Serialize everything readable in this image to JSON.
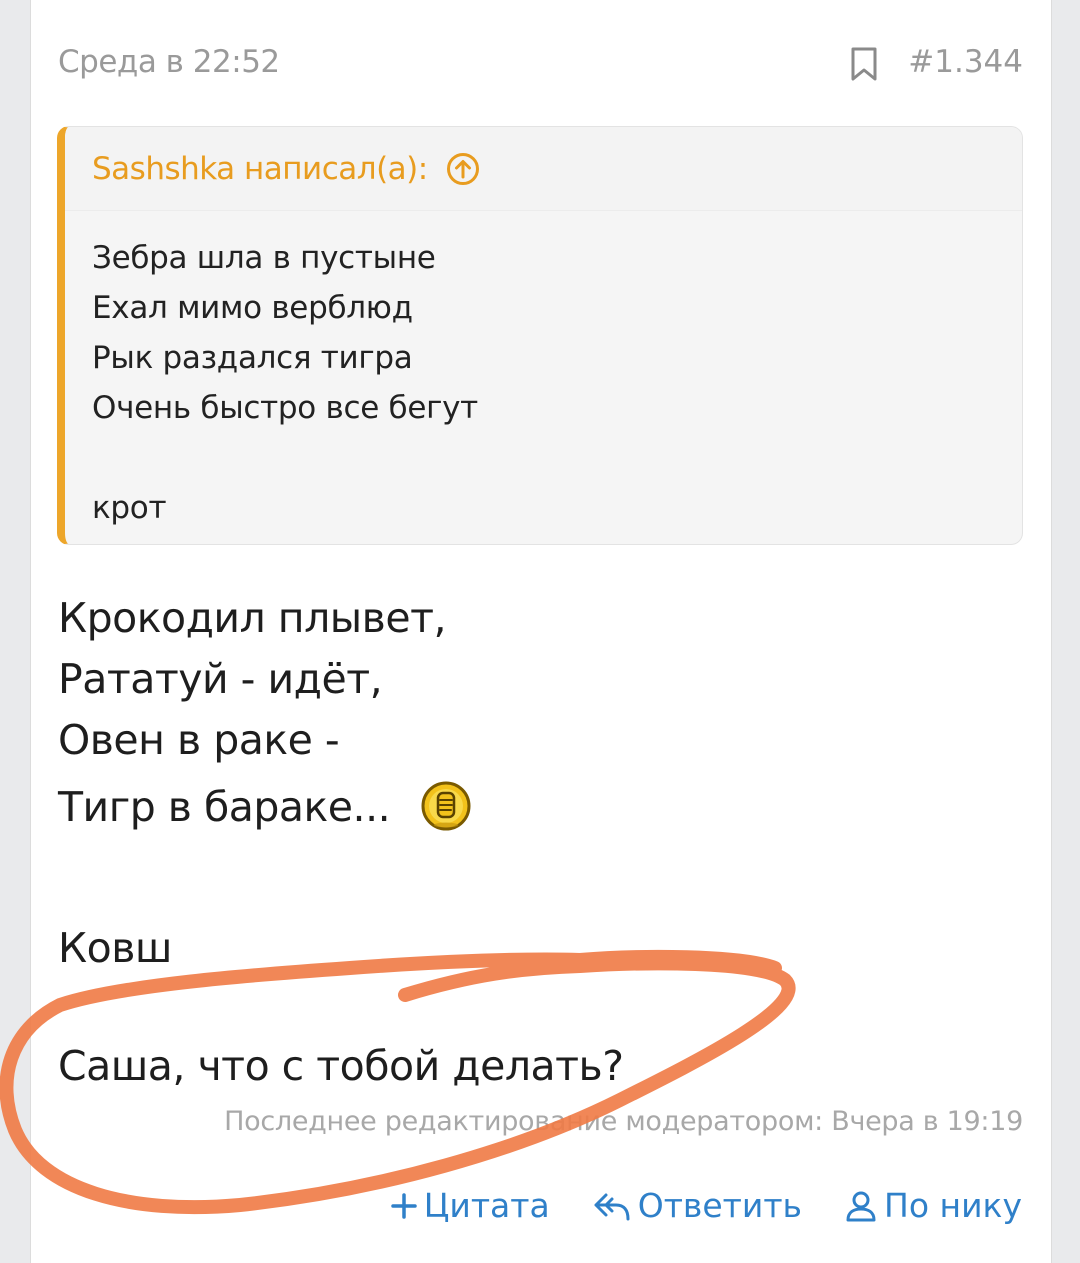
{
  "post": {
    "date": "Среда в 22:52",
    "number": "#1.344",
    "quote": {
      "author": "Sashshka написал(а):",
      "lines": [
        "Зебра шла в пустыне",
        "Ехал мимо верблюд",
        "Рык раздался тигра",
        "Очень быстро все бегут",
        "",
        "крот"
      ]
    },
    "lines": [
      "Крокодил плывет,",
      "Рататуй - идёт,",
      "Овен в раке -",
      "Тигр в бараке...",
      "",
      "Ковш",
      "",
      "Саша, что с тобой делать?"
    ],
    "edit_note": "Последнее редактирование модератором: Вчера в 19:19",
    "actions": {
      "quote": "Цитата",
      "reply": "Ответить",
      "by_nick": "По нику"
    }
  },
  "colors": {
    "accent_orange": "#eda62a",
    "link_blue": "#2f80c9",
    "annotation_stroke": "#f07a45"
  },
  "icons": {
    "bookmark": "bookmark-icon",
    "quote_jump": "arrow-up-circle-icon",
    "smiley": "thumbs-up-smiley-icon",
    "quote_action": "plus-icon",
    "reply_action": "reply-arrow-icon",
    "user_action": "user-icon"
  }
}
